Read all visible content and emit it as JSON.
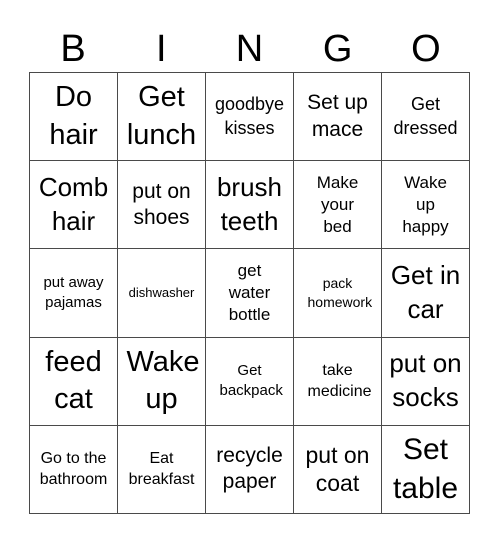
{
  "header": {
    "letters": [
      "B",
      "I",
      "N",
      "G",
      "O"
    ]
  },
  "grid": {
    "cells": [
      [
        "Do hair",
        "Get lunch",
        "goodbye kisses",
        "Set up mace",
        "Get dressed"
      ],
      [
        "Comb hair",
        "put on shoes",
        "brush teeth",
        "Make your bed",
        "Wake up happy"
      ],
      [
        "put away pajamas",
        "dishwasher",
        "get water bottle",
        "pack homework",
        "Get in car"
      ],
      [
        "feed cat",
        "Wake up",
        "Get backpack",
        "take medicine",
        "put on socks"
      ],
      [
        "Go to the bathroom",
        "Eat breakfast",
        "recycle paper",
        "put on coat",
        "Set table"
      ]
    ]
  }
}
